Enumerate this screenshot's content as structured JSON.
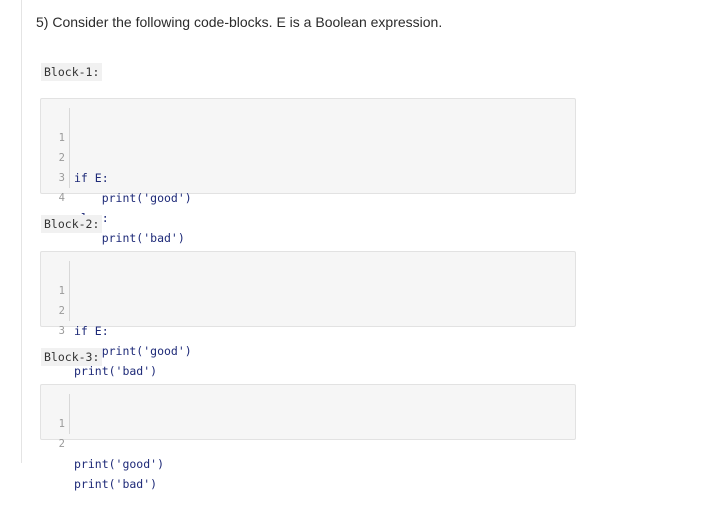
{
  "question": "5) Consider the following code-blocks. E is a Boolean expression.",
  "blocks": [
    {
      "label": "Block-1:",
      "lines": [
        {
          "num": "1",
          "code": "if E:"
        },
        {
          "num": "2",
          "code": "    print('good')"
        },
        {
          "num": "3",
          "code": "else:"
        },
        {
          "num": "4",
          "code": "    print('bad')"
        }
      ]
    },
    {
      "label": "Block-2:",
      "lines": [
        {
          "num": "1",
          "code": "if E:"
        },
        {
          "num": "2",
          "code": "    print('good')"
        },
        {
          "num": "3",
          "code": "print('bad')"
        }
      ]
    },
    {
      "label": "Block-3:",
      "lines": [
        {
          "num": "1",
          "code": "print('good')"
        },
        {
          "num": "2",
          "code": "print('bad')"
        }
      ]
    }
  ]
}
